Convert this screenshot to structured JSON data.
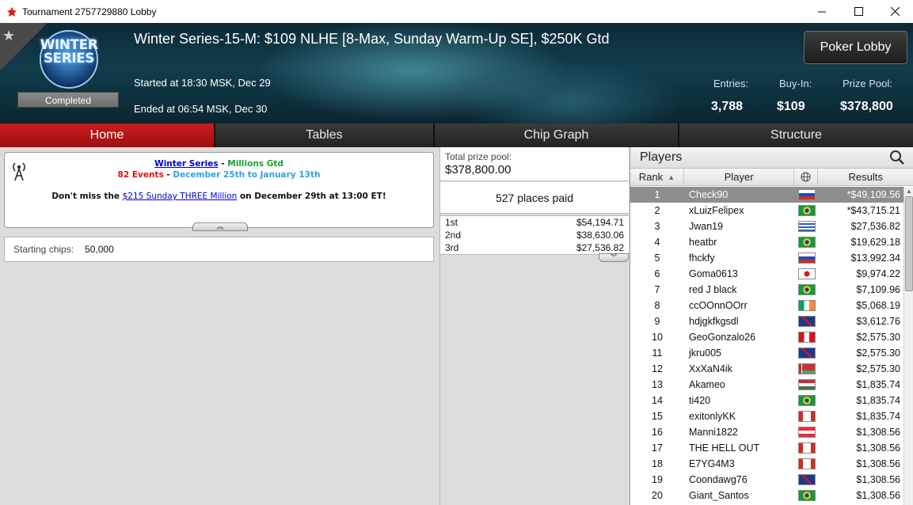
{
  "window": {
    "title": "Tournament 2757729880 Lobby"
  },
  "header": {
    "logo_text": "WINTER\nSERIES",
    "status": "Completed",
    "title": "Winter Series-15-M: $109 NLHE [8-Max, Sunday Warm-Up SE], $250K Gtd",
    "started": "Started at 18:30 MSK, Dec 29",
    "ended": "Ended at 06:54 MSK, Dec 30",
    "lobby_button": "Poker Lobby",
    "stats": {
      "entries_label": "Entries:",
      "entries_value": "3,788",
      "buyin_label": "Buy-In:",
      "buyin_value": "$109",
      "prizepool_label": "Prize Pool:",
      "prizepool_value": "$378,800"
    }
  },
  "tabs": [
    {
      "label": "Home",
      "active": true
    },
    {
      "label": "Tables",
      "active": false
    },
    {
      "label": "Chip Graph",
      "active": false
    },
    {
      "label": "Structure",
      "active": false
    }
  ],
  "promo": {
    "series_link": "Winter Series",
    "dash1": " - ",
    "millions": "Millions Gtd",
    "events": "82 Events",
    "dash2": " - ",
    "dates": "December 25th to January 13th",
    "msg_pre": "Don't miss the ",
    "msg_link": "$215 Sunday THREE Million",
    "msg_post": " on December 29th at 13:00 ET!"
  },
  "home": {
    "starting_chips_label": "Starting chips:",
    "starting_chips_value": "50,000"
  },
  "prizes": {
    "total_label": "Total prize pool:",
    "total_value": "$378,800.00",
    "places_paid": "527 places paid",
    "payouts": [
      {
        "place": "1st",
        "amount": "$54,194.71"
      },
      {
        "place": "2nd",
        "amount": "$38,630.06"
      },
      {
        "place": "3rd",
        "amount": "$27,536.82"
      }
    ]
  },
  "players": {
    "title": "Players",
    "columns": {
      "rank": "Rank",
      "player": "Player",
      "results": "Results"
    },
    "rows": [
      {
        "rank": "1",
        "name": "Check90",
        "flag": "ru",
        "result": "*$49,109.56"
      },
      {
        "rank": "2",
        "name": "xLuizFelipex",
        "flag": "br",
        "result": "*$43,715.21"
      },
      {
        "rank": "3",
        "name": "Jwan19",
        "flag": "uy",
        "result": "$27,536.82"
      },
      {
        "rank": "4",
        "name": "heatbr",
        "flag": "br",
        "result": "$19,629.18"
      },
      {
        "rank": "5",
        "name": "fhckfy",
        "flag": "ru",
        "result": "$13,992.34"
      },
      {
        "rank": "6",
        "name": "Goma0613",
        "flag": "jp",
        "result": "$9,974.22"
      },
      {
        "rank": "7",
        "name": "red J black",
        "flag": "br",
        "result": "$7,109.96"
      },
      {
        "rank": "8",
        "name": "ccOOnnOOrr",
        "flag": "ie",
        "result": "$5,068.19"
      },
      {
        "rank": "9",
        "name": "hdjgkfkgsdl",
        "flag": "gb",
        "result": "$3,612.76"
      },
      {
        "rank": "10",
        "name": "GeoGonzalo26",
        "flag": "pe",
        "result": "$2,575.30"
      },
      {
        "rank": "11",
        "name": "jkru005",
        "flag": "gb",
        "result": "$2,575.30"
      },
      {
        "rank": "12",
        "name": "XxXaN4ik",
        "flag": "by",
        "result": "$2,575.30"
      },
      {
        "rank": "13",
        "name": "Akameo",
        "flag": "hu",
        "result": "$1,835.74"
      },
      {
        "rank": "14",
        "name": "ti420",
        "flag": "br",
        "result": "$1,835.74"
      },
      {
        "rank": "15",
        "name": "exitonlyKK",
        "flag": "ca",
        "result": "$1,835.74"
      },
      {
        "rank": "16",
        "name": "Manni1822",
        "flag": "at",
        "result": "$1,308.56"
      },
      {
        "rank": "17",
        "name": "THE HELL OUT",
        "flag": "ca",
        "result": "$1,308.56"
      },
      {
        "rank": "18",
        "name": "E7YG4M3",
        "flag": "ca",
        "result": "$1,308.56"
      },
      {
        "rank": "19",
        "name": "Coondawg76",
        "flag": "gb",
        "result": "$1,308.56"
      },
      {
        "rank": "20",
        "name": "Giant_Santos",
        "flag": "br",
        "result": "$1,308.56"
      }
    ]
  },
  "colors": {
    "active_tab": "#c81e1e",
    "selected_row": "#8e8e8e",
    "link": "#0000cc",
    "green": "#15a533",
    "red": "#e01010",
    "blue": "#2aa3e8"
  }
}
